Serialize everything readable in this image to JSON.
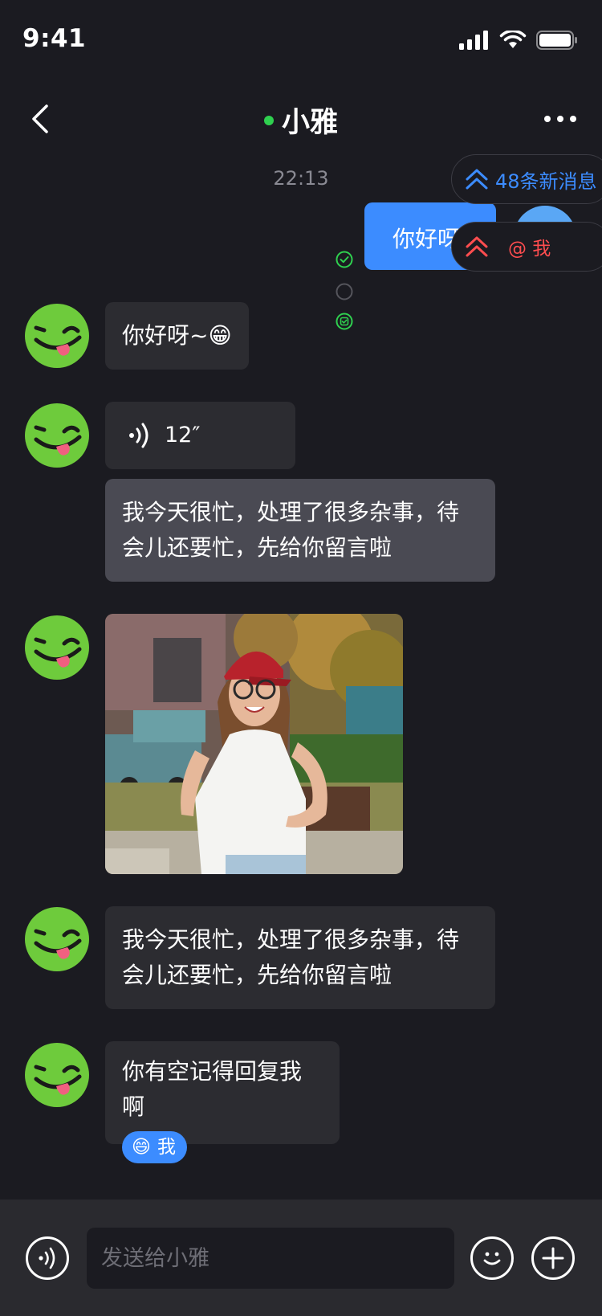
{
  "status_bar": {
    "time": "9:41"
  },
  "header": {
    "title": "小雅",
    "online": true
  },
  "timestamp": "22:13",
  "outgoing": {
    "text": "你好呀"
  },
  "badges": {
    "new_messages": "48条新消息",
    "mention_me": "@ 我"
  },
  "messages": [
    {
      "type": "text",
      "text": "你好呀~😁"
    },
    {
      "type": "voice",
      "duration": "12″"
    },
    {
      "type": "text",
      "text": "我今天很忙，处理了很多杂事，待会儿还要忙，先给你留言啦"
    },
    {
      "type": "image"
    },
    {
      "type": "text",
      "text": "我今天很忙，处理了很多杂事，待会儿还要忙，先给你留言啦"
    },
    {
      "type": "text_mention",
      "text": "你有空记得回复我啊",
      "mention_emoji": "😄",
      "mention_label": "我"
    }
  ],
  "input": {
    "placeholder": "发送给小雅"
  },
  "colors": {
    "background": "#1b1b21",
    "accent_blue": "#3c8cff",
    "mention_red": "#ff4d4f",
    "online_green": "#2fd04f",
    "bubble_incoming": "#2c2c31",
    "avatar_green": "#6ecb3c"
  },
  "icons": [
    "back-chevron-icon",
    "more-icon",
    "check-circle-icon",
    "empty-circle-icon",
    "read-circle-icon",
    "double-chevron-up-icon",
    "voice-wave-icon",
    "emoji-icon",
    "plus-icon",
    "signal-icon",
    "wifi-icon",
    "battery-icon"
  ]
}
